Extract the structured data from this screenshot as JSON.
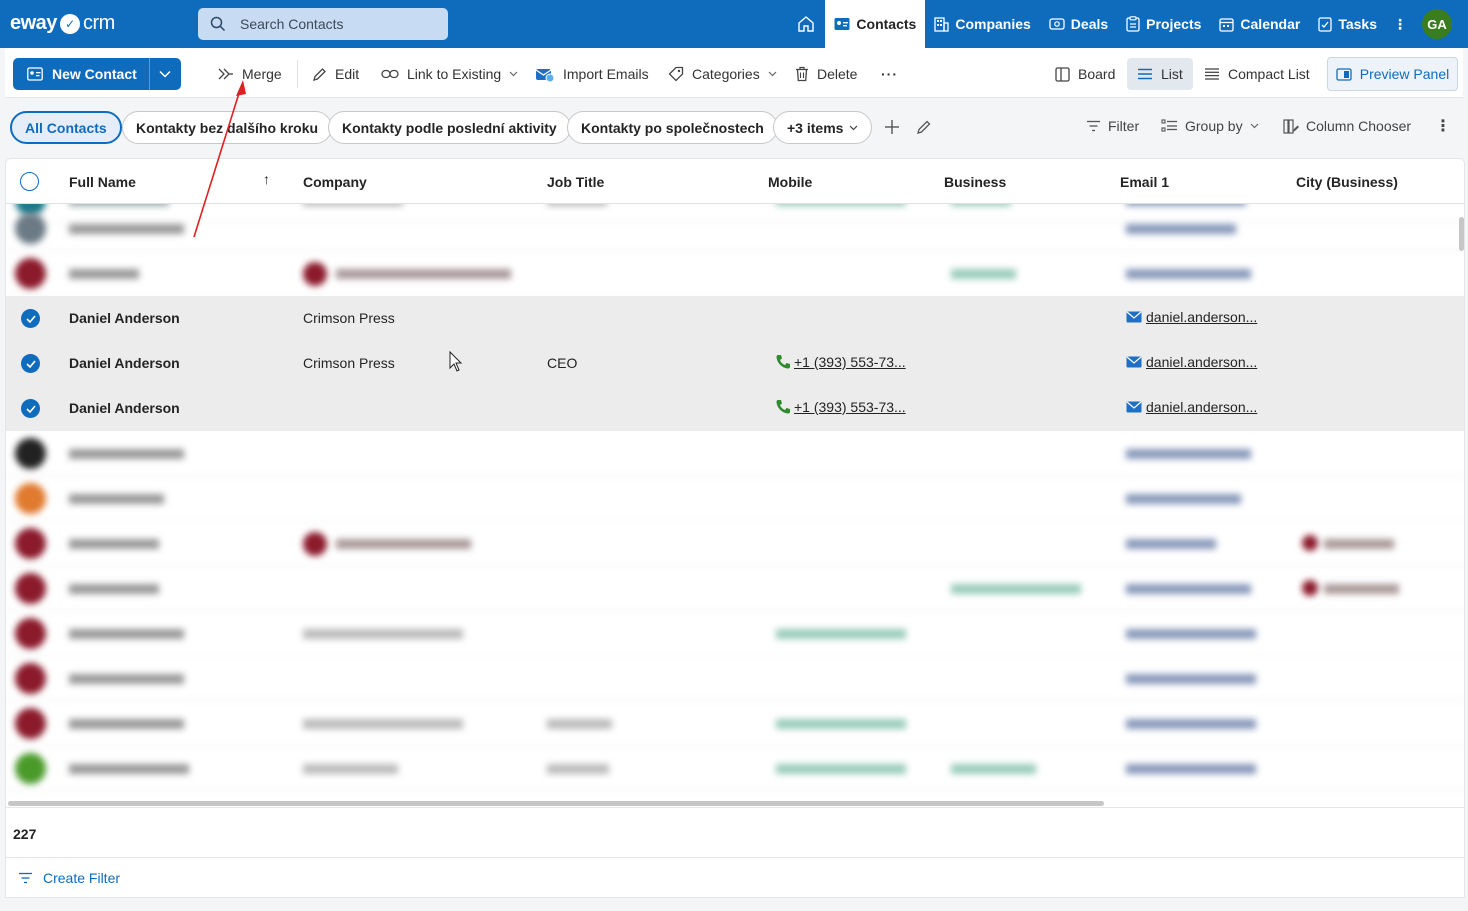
{
  "app": {
    "logo_main": "eway",
    "logo_suffix": "crm",
    "user_initials": "GA"
  },
  "search": {
    "placeholder": "Search Contacts"
  },
  "nav": {
    "contacts": "Contacts",
    "companies": "Companies",
    "deals": "Deals",
    "projects": "Projects",
    "calendar": "Calendar",
    "tasks": "Tasks"
  },
  "toolbar": {
    "new_contact": "New Contact",
    "merge": "Merge",
    "edit": "Edit",
    "link_existing": "Link to Existing",
    "import_emails": "Import Emails",
    "categories": "Categories",
    "delete": "Delete",
    "board": "Board",
    "list": "List",
    "compact_list": "Compact List",
    "preview_panel": "Preview Panel"
  },
  "filters": {
    "all_contacts": "All Contacts",
    "f1": "Kontakty bez dalšího kroku",
    "f2": "Kontakty podle poslední aktivity",
    "f3": "Kontakty po společnostech",
    "more": "+3 items",
    "filter": "Filter",
    "group_by": "Group by",
    "column_chooser": "Column Chooser"
  },
  "columns": {
    "full_name": "Full Name",
    "company": "Company",
    "job_title": "Job Title",
    "mobile": "Mobile",
    "business": "Business",
    "email1": "Email 1",
    "city": "City (Business)"
  },
  "selected_rows": [
    {
      "name": "Daniel Anderson",
      "company": "Crimson Press",
      "job": "",
      "mobile": "",
      "email": "daniel.anderson..."
    },
    {
      "name": "Daniel Anderson",
      "company": "Crimson Press",
      "job": "CEO",
      "mobile": "+1 (393) 553-73...",
      "email": "daniel.anderson..."
    },
    {
      "name": "Daniel Anderson",
      "company": "",
      "job": "",
      "mobile": "+1 (393) 553-73...",
      "email": "daniel.anderson..."
    }
  ],
  "footer": {
    "count": "227",
    "create_filter": "Create Filter"
  },
  "colors": {
    "brand": "#0f6cbd",
    "selected_row": "#ececec",
    "avatar_green": "#3a7d1f"
  }
}
